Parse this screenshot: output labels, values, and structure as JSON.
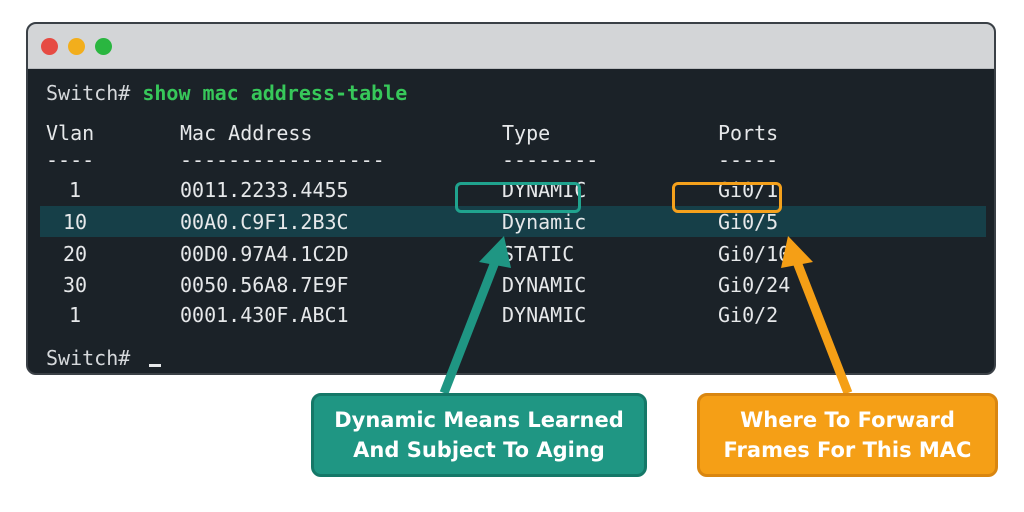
{
  "terminal": {
    "command_prompt": "Switch#",
    "command": "show mac address-table",
    "final_prompt": "Switch#",
    "headers": {
      "vlan": "Vlan",
      "mac": "Mac Address",
      "type": "Type",
      "ports": "Ports"
    },
    "separators": {
      "vlan": "----",
      "mac": "-----------------",
      "type": "--------",
      "ports": "-----"
    },
    "rows": [
      {
        "vlan": "1",
        "mac": "0011.2233.4455",
        "type": "DYNAMIC",
        "port": "Gi0/1"
      },
      {
        "vlan": "10",
        "mac": "00A0.C9F1.2B3C",
        "type": "Dynamic",
        "port": "Gi0/5"
      },
      {
        "vlan": "20",
        "mac": "00D0.97A4.1C2D",
        "type": "STATIC",
        "port": "Gi0/10"
      },
      {
        "vlan": "30",
        "mac": "0050.56A8.7E9F",
        "type": "DYNAMIC",
        "port": "Gi0/24"
      },
      {
        "vlan": "1",
        "mac": "0001.430F.ABC1",
        "type": "DYNAMIC",
        "port": "Gi0/2"
      }
    ]
  },
  "callouts": {
    "type_note": {
      "line1": "Dynamic Means Learned",
      "line2": "And Subject To Aging"
    },
    "port_note": {
      "line1": "Where To Forward",
      "line2": "Frames For This MAC"
    }
  },
  "colors": {
    "accent_teal": "#1f9683",
    "accent_orange": "#f59f16",
    "command_green": "#37c85a",
    "terminal_bg": "#1b2228"
  }
}
